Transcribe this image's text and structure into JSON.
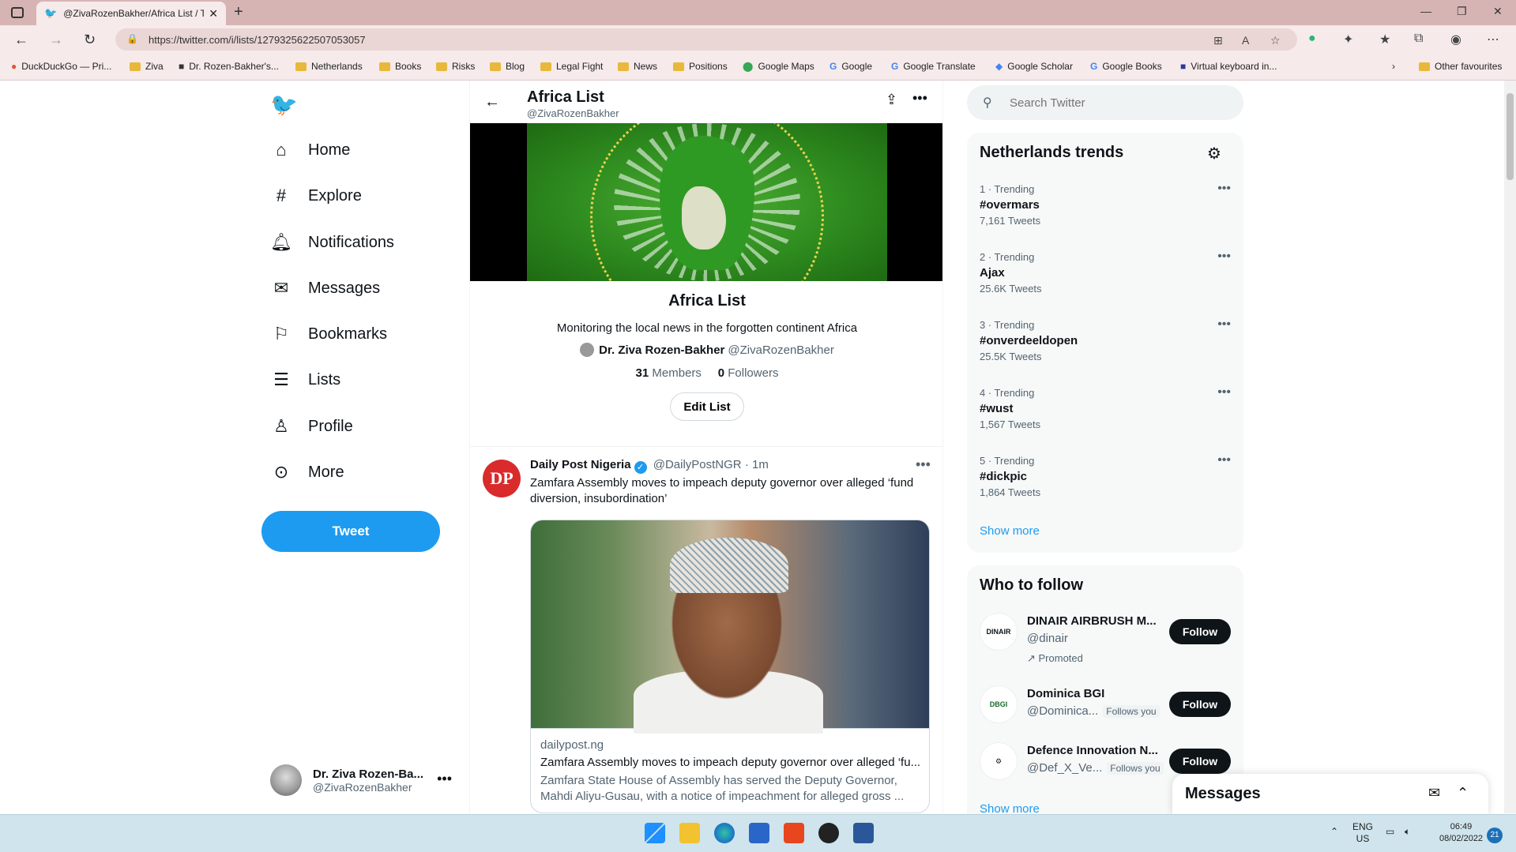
{
  "browser": {
    "tab_title": "@ZivaRozenBakher/Africa List / T",
    "url": "https://twitter.com/i/lists/1279325622507053057",
    "bookmarks": [
      "DuckDuckGo — Pri...",
      "Ziva",
      "Dr. Rozen-Bakher's...",
      "Netherlands",
      "Books",
      "Risks",
      "Blog",
      "Legal Fight",
      "News",
      "Positions",
      "Google Maps",
      "Google",
      "Google Translate",
      "Google Scholar",
      "Google Books",
      "Virtual keyboard in..."
    ],
    "other_favourites": "Other favourites"
  },
  "nav": {
    "items": [
      "Home",
      "Explore",
      "Notifications",
      "Messages",
      "Bookmarks",
      "Lists",
      "Profile",
      "More"
    ],
    "tweet_button": "Tweet",
    "account_name": "Dr. Ziva Rozen-Ba...",
    "account_handle": "@ZivaRozenBakher"
  },
  "list": {
    "header_title": "Africa List",
    "header_handle": "@ZivaRozenBakher",
    "name": "Africa List",
    "description": "Monitoring the local news in the forgotten continent Africa",
    "owner_name": "Dr. Ziva Rozen-Bakher",
    "owner_handle": "@ZivaRozenBakher",
    "members_count": "31",
    "members_label": "Members",
    "followers_count": "0",
    "followers_label": "Followers",
    "edit_button": "Edit List"
  },
  "tweet": {
    "avatar_text": "DP",
    "author": "Daily Post Nigeria",
    "handle": "@DailyPostNGR",
    "time": "· 1m",
    "text": "Zamfara Assembly moves to impeach deputy governor over alleged ‘fund diversion, insubordination’",
    "card_domain": "dailypost.ng",
    "card_title": "Zamfara Assembly moves to impeach deputy governor over alleged ‘fu...",
    "card_desc": "Zamfara State House of Assembly has served the Deputy Governor, Mahdi Aliyu-Gusau, with a notice of impeachment for alleged gross ..."
  },
  "search": {
    "placeholder": "Search Twitter"
  },
  "trends": {
    "title": "Netherlands trends",
    "items": [
      {
        "meta": "1 · Trending",
        "topic": "#overmars",
        "count": "7,161 Tweets"
      },
      {
        "meta": "2 · Trending",
        "topic": "Ajax",
        "count": "25.6K Tweets"
      },
      {
        "meta": "3 · Trending",
        "topic": "#onverdeeldopen",
        "count": "25.5K Tweets"
      },
      {
        "meta": "4 · Trending",
        "topic": "#wust",
        "count": "1,567 Tweets"
      },
      {
        "meta": "5 · Trending",
        "topic": "#dickpic",
        "count": "1,864 Tweets"
      }
    ],
    "show_more": "Show more"
  },
  "who_to_follow": {
    "title": "Who to follow",
    "items": [
      {
        "avatar": "DINAIR",
        "name": "DINAIR AIRBRUSH M...",
        "handle": "@dinair",
        "follows_you": "",
        "promoted": "Promoted"
      },
      {
        "avatar": "DBGI",
        "name": "Dominica BGI",
        "handle": "@Dominica...",
        "follows_you": "Follows you",
        "promoted": ""
      },
      {
        "avatar": "DI",
        "name": "Defence Innovation N...",
        "handle": "@Def_X_Ve...",
        "follows_you": "Follows you",
        "promoted": ""
      }
    ],
    "follow_label": "Follow",
    "show_more": "Show more"
  },
  "messages_dock": {
    "title": "Messages"
  },
  "taskbar": {
    "lang1": "ENG",
    "lang2": "US",
    "time": "06:49",
    "date": "08/02/2022",
    "notifications": "21"
  },
  "colors": {
    "twitter_blue": "#1d9bf0",
    "text": "#0f1419",
    "muted": "#536471",
    "chrome": "#f6eaea"
  }
}
